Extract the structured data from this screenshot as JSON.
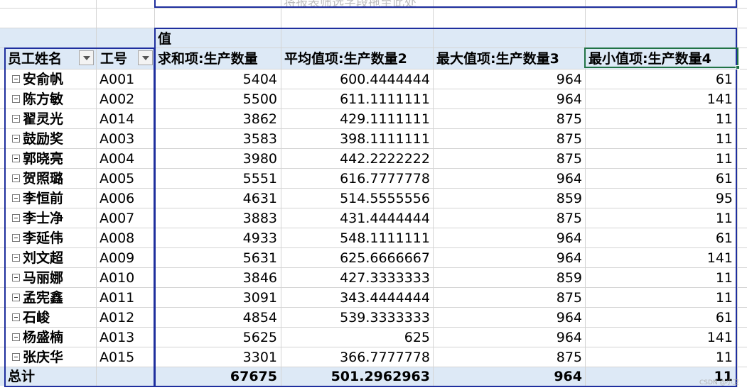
{
  "top_cell_text": "将报表筛选字段拖至此处",
  "values_label": "值",
  "columns": {
    "name": "员工姓名",
    "id": "工号",
    "sum": "求和项:生产数量",
    "avg": "平均值项:生产数量2",
    "max": "最大值项:生产数量3",
    "min": "最小值项:生产数量4"
  },
  "rows": [
    {
      "name": "安俞帆",
      "id": "A001",
      "sum": "5404",
      "avg": "600.4444444",
      "max": "964",
      "min": "61"
    },
    {
      "name": "陈方敏",
      "id": "A002",
      "sum": "5500",
      "avg": "611.1111111",
      "max": "964",
      "min": "141"
    },
    {
      "name": "翟灵光",
      "id": "A014",
      "sum": "3862",
      "avg": "429.1111111",
      "max": "875",
      "min": "11"
    },
    {
      "name": "鼓励奖",
      "id": "A003",
      "sum": "3583",
      "avg": "398.1111111",
      "max": "875",
      "min": "11"
    },
    {
      "name": "郭晓亮",
      "id": "A004",
      "sum": "3980",
      "avg": "442.2222222",
      "max": "875",
      "min": "11"
    },
    {
      "name": "贺照璐",
      "id": "A005",
      "sum": "5551",
      "avg": "616.7777778",
      "max": "964",
      "min": "61"
    },
    {
      "name": "李恒前",
      "id": "A006",
      "sum": "4631",
      "avg": "514.5555556",
      "max": "859",
      "min": "95"
    },
    {
      "name": "李士净",
      "id": "A007",
      "sum": "3883",
      "avg": "431.4444444",
      "max": "875",
      "min": "11"
    },
    {
      "name": "李延伟",
      "id": "A008",
      "sum": "4933",
      "avg": "548.1111111",
      "max": "964",
      "min": "61"
    },
    {
      "name": "刘文超",
      "id": "A009",
      "sum": "5631",
      "avg": "625.6666667",
      "max": "964",
      "min": "141"
    },
    {
      "name": "马丽娜",
      "id": "A010",
      "sum": "3846",
      "avg": "427.3333333",
      "max": "859",
      "min": "11"
    },
    {
      "name": "孟宪鑫",
      "id": "A011",
      "sum": "3091",
      "avg": "343.4444444",
      "max": "875",
      "min": "11"
    },
    {
      "name": "石峻",
      "id": "A012",
      "sum": "4854",
      "avg": "539.3333333",
      "max": "964",
      "min": "61"
    },
    {
      "name": "杨盛楠",
      "id": "A013",
      "sum": "5625",
      "avg": "625",
      "max": "964",
      "min": "141"
    },
    {
      "name": "张庆华",
      "id": "A015",
      "sum": "3301",
      "avg": "366.7777778",
      "max": "875",
      "min": "11"
    }
  ],
  "total": {
    "label": "总计",
    "sum": "67675",
    "avg": "501.2962963",
    "max": "964",
    "min": "11"
  },
  "watermark": "CSDN @小卫",
  "colors": {
    "pivot_border": "#1f2f9e",
    "header_fill": "#dde9f6",
    "selection": "#217346",
    "grid": "#d4d4d4"
  }
}
